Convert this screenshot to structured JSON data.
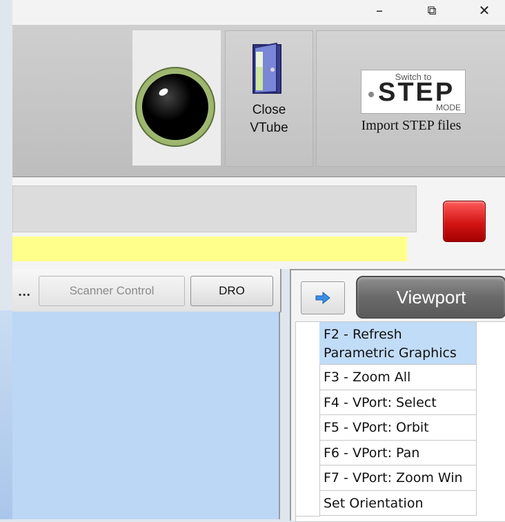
{
  "window": {
    "minimize_glyph": "–",
    "maximize_glyph": "⧉",
    "close_glyph": "✕"
  },
  "toolbar": {
    "close_vtube": {
      "line1": "Close",
      "line2": "VTube"
    },
    "step_mode": {
      "logo_top": "Switch to",
      "logo_main": "STEP",
      "logo_bottom": "MODE",
      "label": "Import STEP files"
    }
  },
  "left_panel": {
    "overflow": "...",
    "scanner_control": "Scanner Control",
    "dro": "DRO"
  },
  "right_panel": {
    "viewport": "Viewport",
    "items": [
      {
        "label": "F2 - Refresh Parametric Graphics",
        "selected": true
      },
      {
        "label": "F3 - Zoom All"
      },
      {
        "label": "F4 - VPort: Select"
      },
      {
        "label": "F5 - VPort: Orbit"
      },
      {
        "label": "F6 - VPort: Pan"
      },
      {
        "label": "F7 - VPort: Zoom Win"
      },
      {
        "label": "Set Orientation"
      }
    ]
  },
  "colors": {
    "status_yellow": "#ffff8c",
    "stop_red": "#d41414",
    "selection": "#c1dcf7",
    "scene_bg": "#bcd6f5"
  }
}
